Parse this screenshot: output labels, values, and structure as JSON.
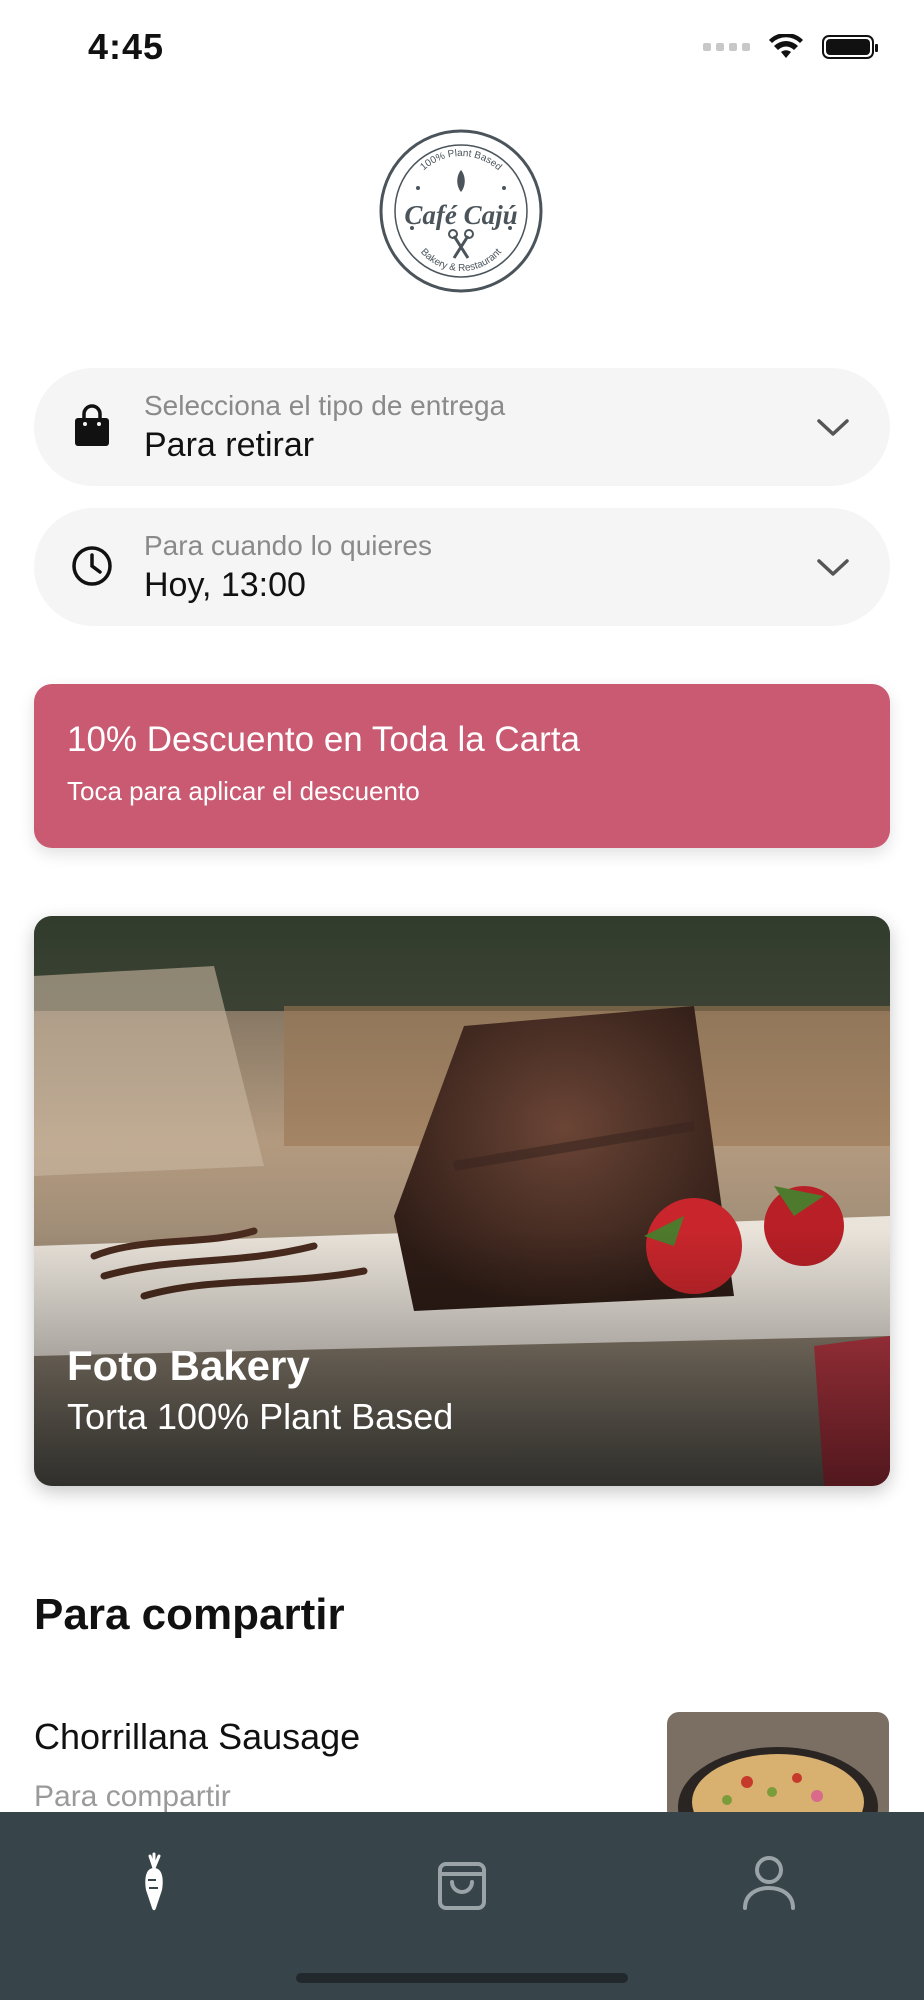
{
  "status_bar": {
    "time": "4:45"
  },
  "brand": {
    "name": "Café Cajú",
    "logo_top_text": "100% Plant Based",
    "logo_bottom_text": "Bakery & Restaurant"
  },
  "delivery": {
    "label": "Selecciona el tipo de entrega",
    "value": "Para retirar",
    "icon": "shopping-bag-icon"
  },
  "schedule": {
    "label": "Para cuando lo quieres",
    "value": "Hoy, 13:00",
    "icon": "clock-icon"
  },
  "promo": {
    "title": "10% Descuento en Toda la Carta",
    "subtitle": "Toca para aplicar el descuento",
    "color": "#c95a72"
  },
  "hero": {
    "title": "Foto Bakery",
    "subtitle": "Torta 100% Plant Based"
  },
  "section": {
    "title": "Para compartir",
    "items": [
      {
        "name": "Chorrillana Sausage",
        "category": "Para compartir"
      }
    ]
  },
  "tab_bar": {
    "tabs": [
      {
        "icon": "carrot-icon",
        "active": true
      },
      {
        "icon": "shopping-bag-icon",
        "active": false
      },
      {
        "icon": "user-icon",
        "active": false
      }
    ],
    "color": "#37444a"
  }
}
